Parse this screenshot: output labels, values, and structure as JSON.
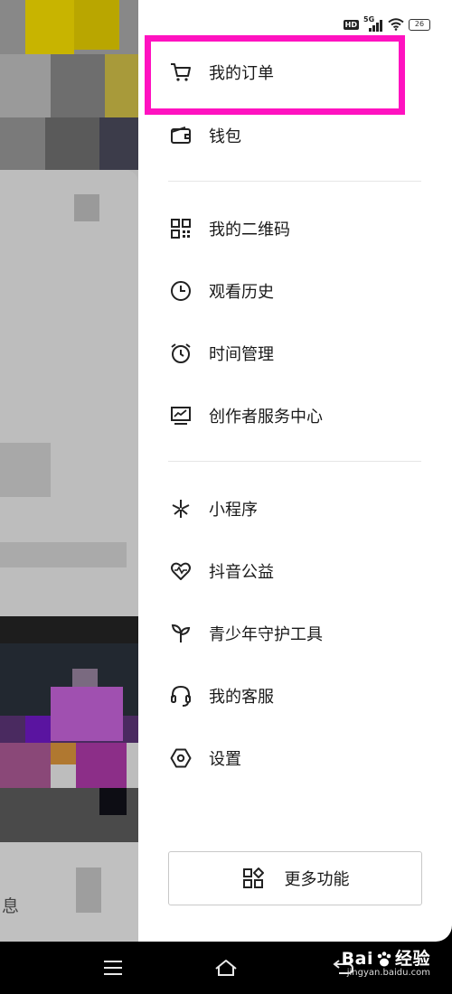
{
  "status_bar": {
    "hd": "HD",
    "network": "5G",
    "battery": "26"
  },
  "menu": {
    "orders": "我的订单",
    "wallet": "钱包",
    "qrcode": "我的二维码",
    "history": "观看历史",
    "time_management": "时间管理",
    "creator_center": "创作者服务中心",
    "mini_programs": "小程序",
    "charity": "抖音公益",
    "youth_protection": "青少年守护工具",
    "customer_service": "我的客服",
    "settings": "设置"
  },
  "more_button": "更多功能",
  "background": {
    "partial_text": "息"
  },
  "watermark": {
    "brand_left": "Bai",
    "brand_right": "经验",
    "url": "jingyan.baidu.com"
  },
  "colors": {
    "highlight": "#ff12c0",
    "drawer_bg": "#ffffff",
    "nav_bg": "#000000"
  }
}
